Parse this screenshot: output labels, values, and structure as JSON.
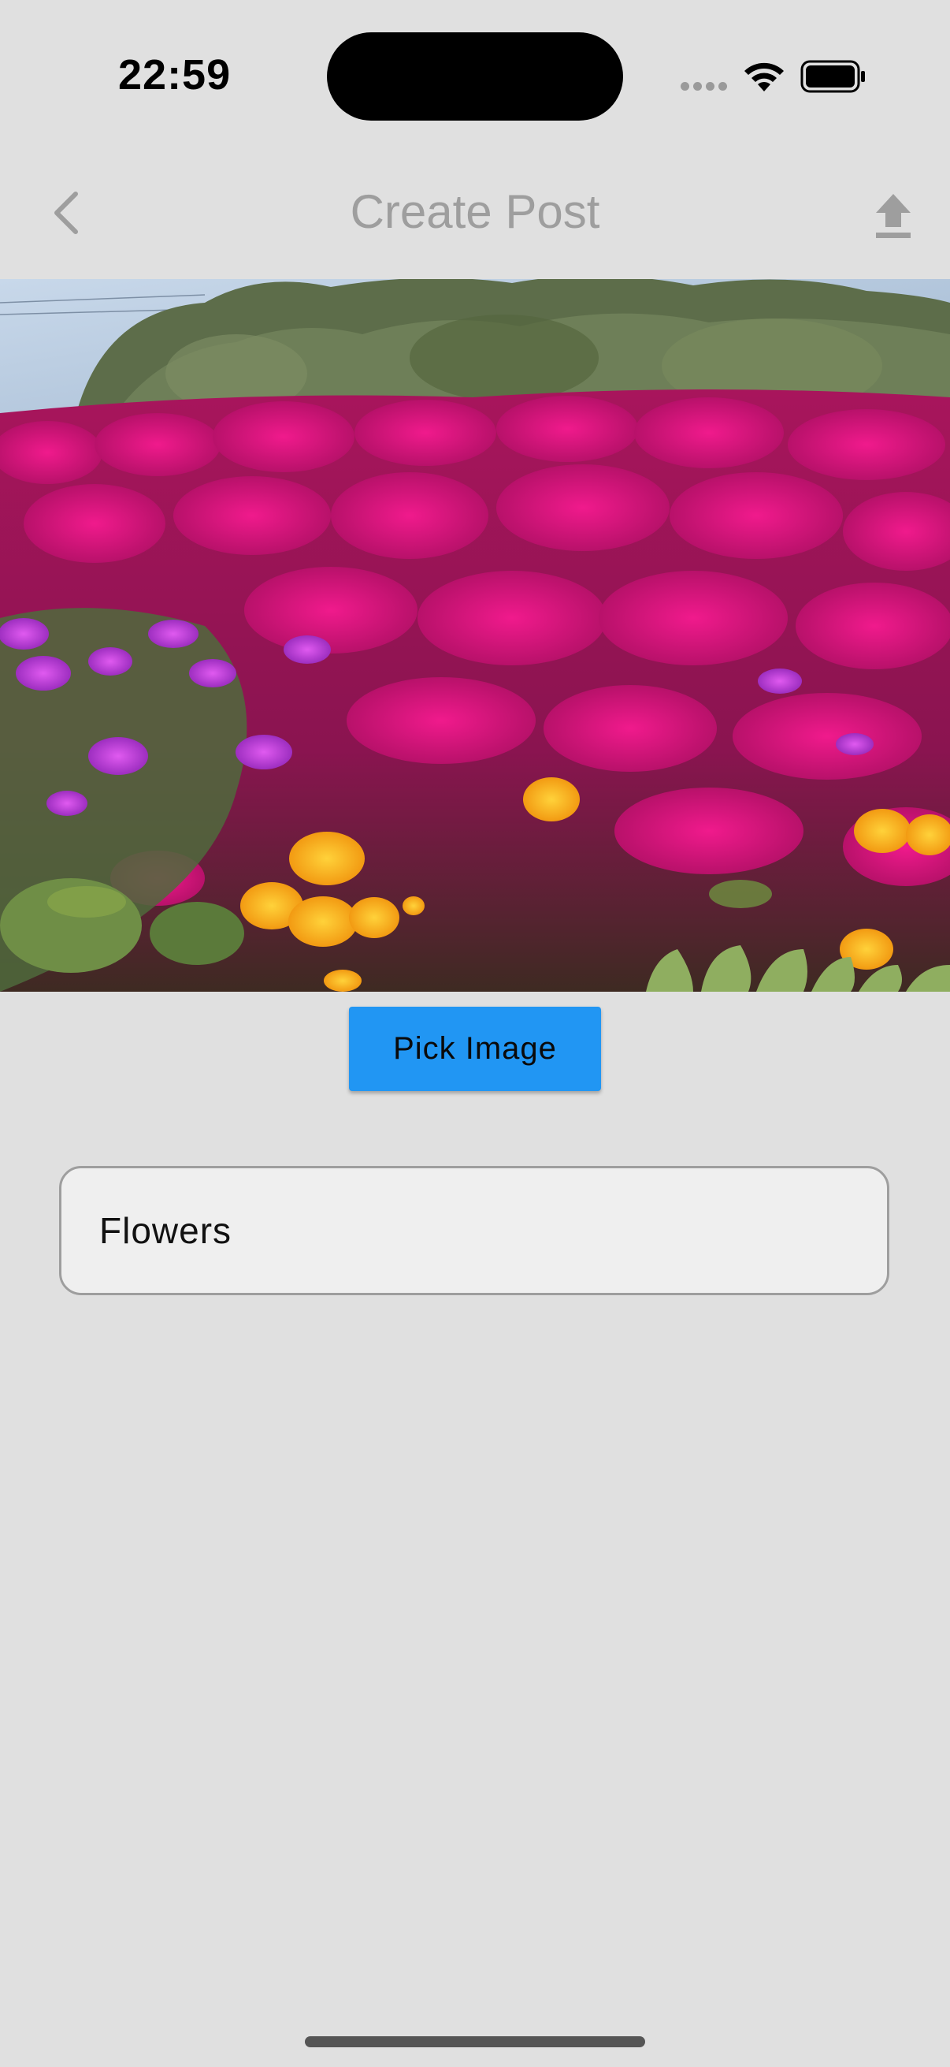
{
  "status_bar": {
    "time": "22:59",
    "icons": [
      "signal-icon",
      "wifi-icon",
      "battery-icon"
    ]
  },
  "app_bar": {
    "title": "Create Post",
    "back_icon": "chevron-left-icon",
    "upload_icon": "upload-icon"
  },
  "photo": {
    "subject": "flowers"
  },
  "pick_button": {
    "label": "Pick Image",
    "color": "#2196f3"
  },
  "caption": {
    "value": "Flowers",
    "placeholder": ""
  },
  "colors": {
    "background": "#e0e0e0",
    "title": "#9e9e9e",
    "accent": "#2196f3"
  }
}
